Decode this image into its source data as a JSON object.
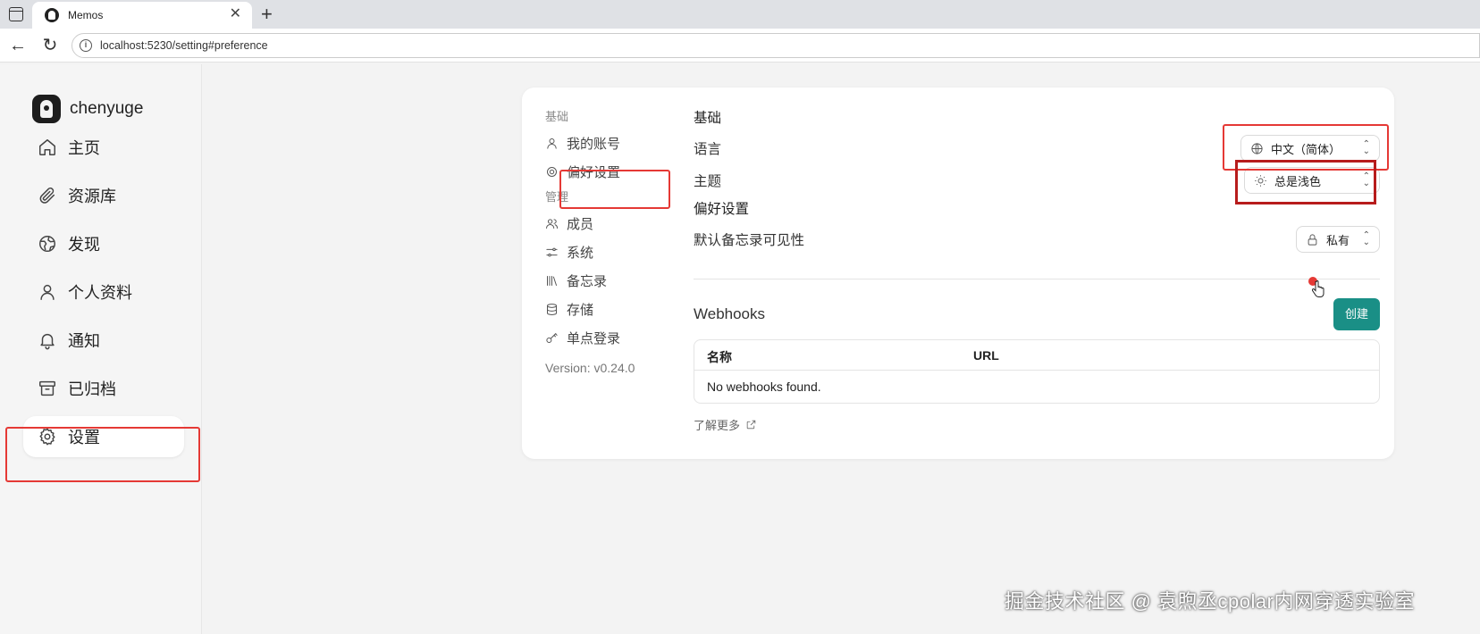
{
  "browser": {
    "tab_title": "Memos",
    "url": "localhost:5230/setting#preference",
    "new_tab_symbol": "+",
    "close_symbol": "✕"
  },
  "sidebar": {
    "username": "chenyuge",
    "items": [
      {
        "label": "主页",
        "icon": "home-icon"
      },
      {
        "label": "资源库",
        "icon": "paperclip-icon"
      },
      {
        "label": "发现",
        "icon": "globe-icon"
      },
      {
        "label": "个人资料",
        "icon": "user-icon"
      },
      {
        "label": "通知",
        "icon": "bell-icon"
      },
      {
        "label": "已归档",
        "icon": "archive-icon"
      },
      {
        "label": "设置",
        "icon": "gear-icon",
        "active": true
      }
    ]
  },
  "settings_nav": {
    "group_basic": "基础",
    "account": "我的账号",
    "preference": "偏好设置",
    "group_admin": "管理",
    "members": "成员",
    "system": "系统",
    "memos": "备忘录",
    "storage": "存储",
    "sso": "单点登录",
    "version": "Version: v0.24.0"
  },
  "preferences": {
    "section_title": "基础",
    "language_label": "语言",
    "language_value": "中文（简体）",
    "theme_label": "主题",
    "theme_value": "总是浅色",
    "subsection_title": "偏好设置",
    "visibility_label": "默认备忘录可见性",
    "visibility_value": "私有"
  },
  "webhooks": {
    "title": "Webhooks",
    "create_label": "创建",
    "col_name": "名称",
    "col_url": "URL",
    "empty_text": "No webhooks found.",
    "learn_more": "了解更多"
  },
  "watermark": "掘金技术社区 @ 袁煦丞cpolar内网穿透实验室",
  "colors": {
    "accent": "#1a8f86",
    "highlight": "#e53935"
  }
}
